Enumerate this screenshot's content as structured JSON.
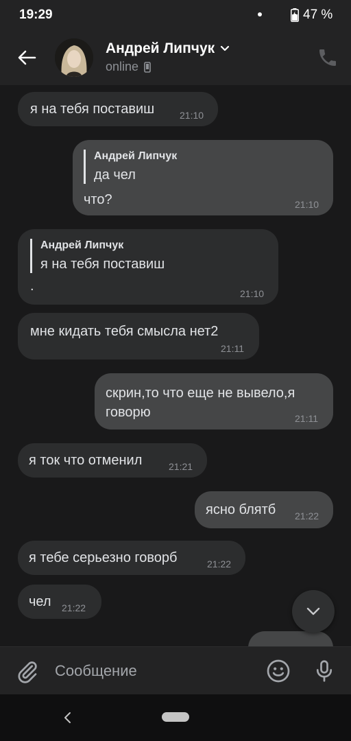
{
  "status_bar": {
    "time": "19:29",
    "battery": "47 %"
  },
  "header": {
    "contact_name": "Андрей Липчук",
    "status": "online"
  },
  "messages": [
    {
      "text": "я на тебя поставиш",
      "time": "21:10"
    },
    {
      "reply_author": "Андрей Липчук",
      "reply_text": "да чел",
      "text": "что?",
      "time": "21:10"
    },
    {
      "reply_author": "Андрей Липчук",
      "reply_text": "я на тебя поставиш",
      "text": ".",
      "time": "21:10"
    },
    {
      "text": "мне кидать тебя смысла нет2",
      "time": "21:11"
    },
    {
      "text_line1": "скрин,то что еще не вывело,я",
      "text_line2": "говорю",
      "time": "21:11"
    },
    {
      "text": "я ток что отменил",
      "time": "21:21"
    },
    {
      "text": "ясно блятб",
      "time": "21:22"
    },
    {
      "text": "я тебе серьезно говорб",
      "time": "21:22"
    },
    {
      "text": "чел",
      "time": "21:22"
    }
  ],
  "composer": {
    "placeholder": "Сообщение"
  },
  "icons": {
    "back": "arrow-left-icon",
    "chevron": "chevron-down-icon",
    "phone": "phone-icon",
    "attach": "paperclip-icon",
    "emoji": "smile-icon",
    "mic": "microphone-icon",
    "scroll": "chevron-down-icon",
    "battery": "battery-icon",
    "nav_back": "nav-back-icon"
  },
  "colors": {
    "background": "#19191a",
    "header": "#232324",
    "incoming_bubble": "#2c2d2e",
    "outgoing_bubble": "#454647",
    "text": "#e1e3e6",
    "muted": "#8f9196"
  }
}
